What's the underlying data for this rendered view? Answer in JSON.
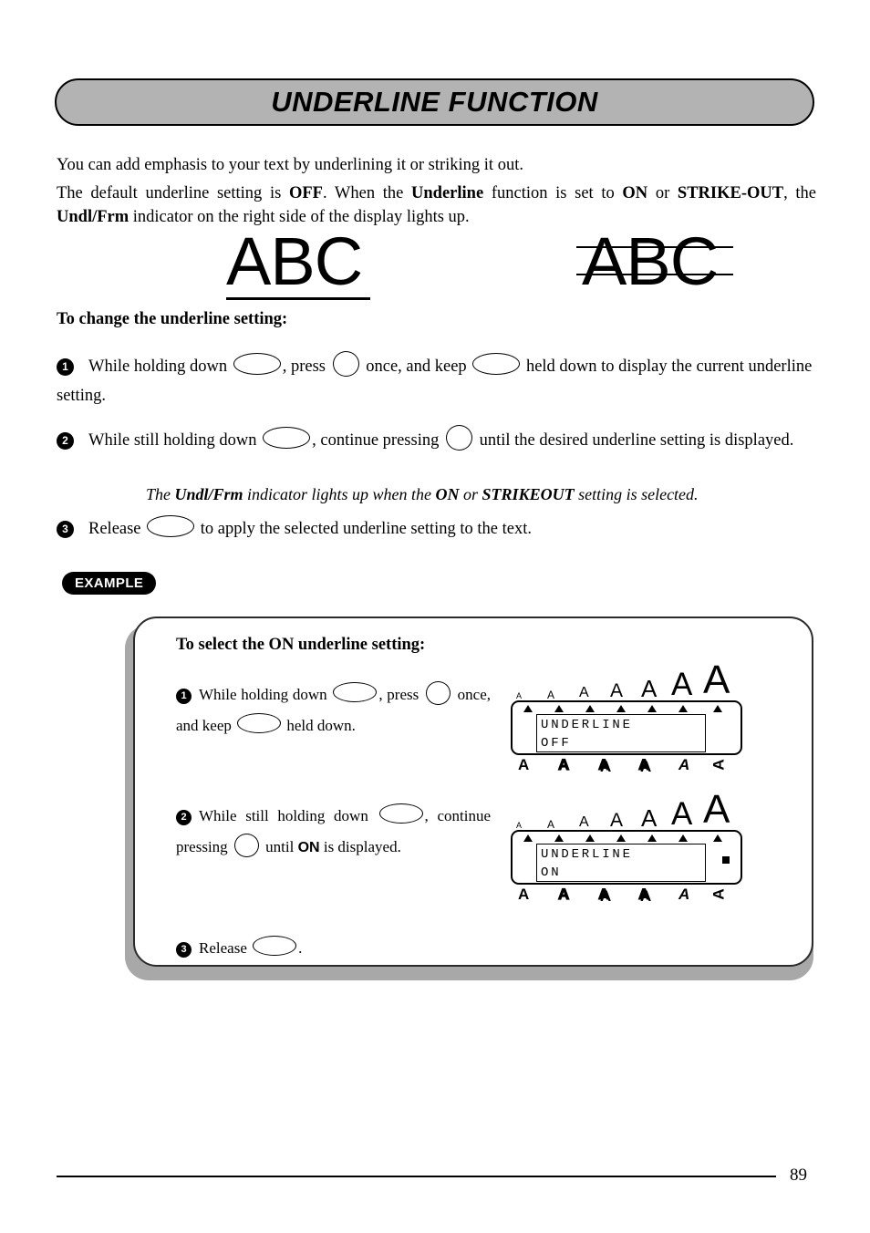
{
  "page": {
    "title": "UNDERLINE FUNCTION",
    "number": "89"
  },
  "intro": {
    "line1": "You can add emphasis to your text by underlining it or striking it out.",
    "line2_a": "The default underline setting is ",
    "line2_off": "OFF",
    "line2_b": ". When the ",
    "line2_underline": "Underline",
    "line2_c": " function is set to ",
    "line2_on": "ON",
    "line2_d": " or ",
    "line2_strikeout": "STRIKE-OUT",
    "line2_e": ", the ",
    "line2_undlfrm": "Undl/Frm",
    "line2_f": " indicator on the right side of the display lights up."
  },
  "samples": {
    "underline_text": "ABC",
    "strikeout_text": "ABC"
  },
  "section": {
    "heading": "To change the underline setting:"
  },
  "steps": [
    {
      "num": "1",
      "a": "While holding down ",
      "key1": "code-key",
      "b": ", press ",
      "key2": "a-key",
      "c": " once, and keep ",
      "key3": "code-key",
      "d": " held down to display the current underline setting."
    },
    {
      "num": "2",
      "a": "While still holding down ",
      "key1": "code-key",
      "b": ", continue pressing ",
      "key2": "a-key",
      "c": " until the desired underline setting is displayed."
    },
    {
      "num": "3",
      "a": "Release ",
      "key1": "code-key",
      "b": " to apply the selected underline setting to the text."
    }
  ],
  "note": {
    "a": "The ",
    "undlfrm": "Undl/Frm",
    "b": " indicator lights up when the ",
    "on": "ON",
    "c": " or ",
    "strikeout": "STRIKEOUT",
    "d": " setting is selected."
  },
  "example": {
    "badge": "EXAMPLE",
    "title": "To select the ON underline setting:",
    "steps": [
      {
        "num": "1",
        "a": "While holding down ",
        "b": ", press ",
        "c": " once, and keep ",
        "d": " held down."
      },
      {
        "num": "2",
        "a": "While still holding down ",
        "b": ", continue pressing ",
        "c": " until ",
        "on": "ON",
        "d": " is displayed."
      },
      {
        "num": "3",
        "a": "Release ",
        "b": "."
      }
    ],
    "displays": [
      {
        "line1": "UNDERLINE",
        "line2": "OFF",
        "indicator_on": false,
        "top_icons": [
          "A",
          "A",
          "A",
          "A",
          "A",
          "A",
          "A"
        ],
        "bottom_icons": [
          "A",
          "A",
          "A",
          "A",
          "A",
          "A"
        ]
      },
      {
        "line1": "UNDERLINE",
        "line2": "ON",
        "indicator_on": true,
        "top_icons": [
          "A",
          "A",
          "A",
          "A",
          "A",
          "A",
          "A"
        ],
        "bottom_icons": [
          "A",
          "A",
          "A",
          "A",
          "A",
          "A"
        ]
      }
    ]
  },
  "colors": {
    "banner_fill": "#b3b3b3",
    "banner_border": "#000000",
    "panel_shadow": "#a8a8a8",
    "badge_fill": "#000000",
    "text": "#000000"
  }
}
